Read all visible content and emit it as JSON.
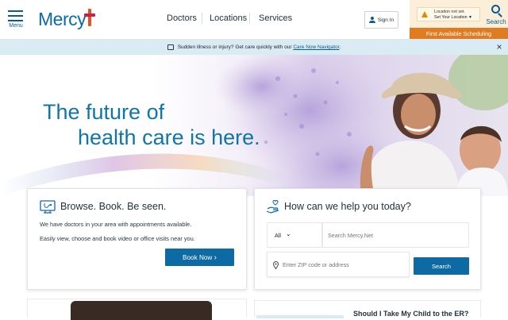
{
  "header": {
    "menu_label": "Menu",
    "logo_text": "Mercy",
    "nav": [
      "Doctors",
      "Locations",
      "Services"
    ],
    "signin_label": "Sign In",
    "location_line1": "Location not set.",
    "location_line2": "Set Your Location",
    "first_available": "First Available Scheduling",
    "search_label": "Search"
  },
  "alert": {
    "text": "Sudden illness or injury? Get care quickly with our",
    "link": "Care Now Navigator",
    "suffix": ".",
    "close_symbol": "×"
  },
  "hero": {
    "line1": "The future of",
    "line2": "health care is here."
  },
  "browse_card": {
    "icon": "monitor-stethoscope-icon",
    "title": "Browse. Book. Be seen.",
    "text1": "We have doctors in your area with appointments available.",
    "text2": "Easily view, choose and book video or office visits near you.",
    "button": "Book Now"
  },
  "help_card": {
    "icon": "helping-hand-icon",
    "title": "How can we help you today?",
    "filter_value": "All",
    "search_placeholder": "Search Mercy.Net",
    "zip_placeholder": "Enter ZIP code or address",
    "search_button": "Search"
  },
  "lower": {
    "er_heading": "Should I Take My Child to the ER?"
  },
  "colors": {
    "brand_blue": "#0e6aa3",
    "hero_text": "#1176a6",
    "accent_orange": "#e07b1f",
    "alert_bg": "#d9ecf3"
  }
}
